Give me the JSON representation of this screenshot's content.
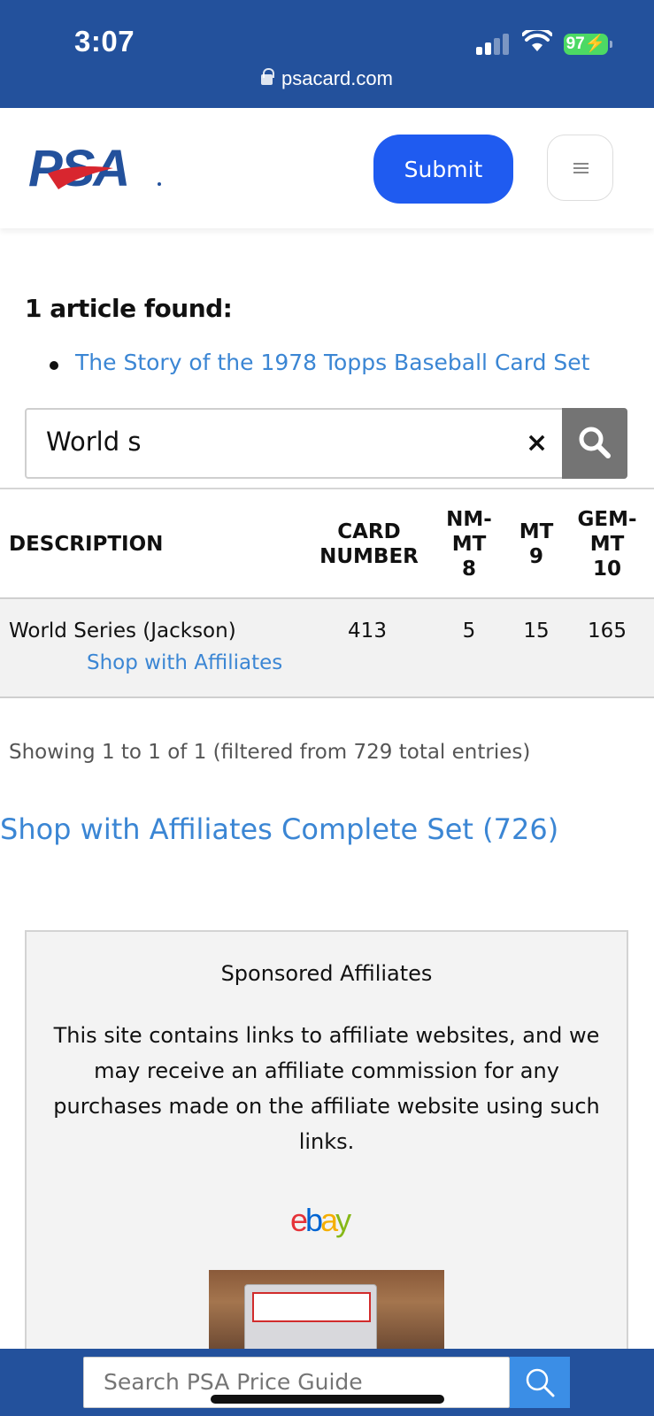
{
  "status_bar": {
    "time": "3:07",
    "battery": "97",
    "url": "psacard.com"
  },
  "header": {
    "logo_text": "PSA",
    "submit_label": "Submit"
  },
  "articles": {
    "heading": "1 article found:",
    "items": [
      {
        "title": "The Story of the 1978 Topps Baseball Card Set"
      }
    ]
  },
  "search": {
    "value": "World s"
  },
  "table": {
    "headers": {
      "description": "DESCRIPTION",
      "card_number": [
        "CARD",
        "NUMBER"
      ],
      "nm_mt_8": [
        "NM-",
        "MT",
        "8"
      ],
      "mt_9": [
        "MT",
        "9"
      ],
      "gem_mt_10": [
        "GEM-",
        "MT",
        "10"
      ]
    },
    "rows": [
      {
        "description": "World Series (Jackson)",
        "link": "Shop with Affiliates",
        "card_number": "413",
        "nm_mt_8": "5",
        "mt_9": "15",
        "gem_mt_10": "165"
      }
    ]
  },
  "summary": {
    "showing": "Showing 1 to 1 of 1 (filtered from 729 total entries)",
    "complete_set_link": "Shop with Affiliates Complete Set (726)"
  },
  "sponsored": {
    "title": "Sponsored Affiliates",
    "description": "This site contains links to affiliate websites, and we may receive an affiliate commission for any purchases made on the affiliate website using such links.",
    "ebay_letters": [
      "e",
      "b",
      "a",
      "y"
    ]
  },
  "bottom_search": {
    "placeholder": "Search PSA Price Guide"
  },
  "colors": {
    "brand_blue": "#23519c",
    "submit_blue": "#1f5bf0",
    "link_blue": "#3b86d4",
    "psa_red": "#d8262f",
    "ebay_red": "#e53238",
    "ebay_blue": "#0064d2",
    "ebay_yellow": "#f5af02",
    "ebay_green": "#86b817"
  }
}
